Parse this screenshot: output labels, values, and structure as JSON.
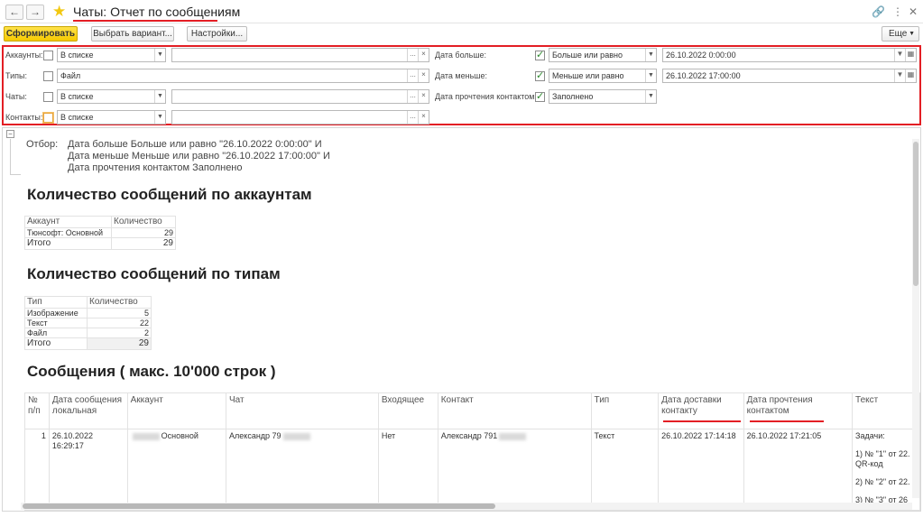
{
  "window": {
    "title": "Чаты: Отчет по сообщениям"
  },
  "toolbar": {
    "generate": "Сформировать",
    "select_variant": "Выбрать вариант...",
    "settings": "Настройки...",
    "more": "Еще"
  },
  "filters": {
    "accounts": {
      "label": "Аккаунты:",
      "checked": false,
      "condition": "В списке",
      "value": ""
    },
    "types": {
      "label": "Типы:",
      "checked": false,
      "condition": "Файл",
      "value": ""
    },
    "chats": {
      "label": "Чаты:",
      "checked": false,
      "condition": "В списке",
      "value": ""
    },
    "contacts": {
      "label": "Контакты:",
      "checked": false,
      "condition": "В списке",
      "value": ""
    },
    "date_greater": {
      "label": "Дата больше:",
      "checked": true,
      "condition": "Больше или равно",
      "value": "26.10.2022  0:00:00"
    },
    "date_less": {
      "label": "Дата меньше:",
      "checked": true,
      "condition": "Меньше или равно",
      "value": "26.10.2022 17:00:00"
    },
    "read_date": {
      "label": "Дата прочтения контактом:",
      "checked": true,
      "condition": "Заполнено"
    }
  },
  "report": {
    "otbor_label": "Отбор:",
    "otbor_lines": [
      "Дата больше Больше или равно \"26.10.2022 0:00:00\" И",
      "Дата меньше Меньше или равно \"26.10.2022 17:00:00\" И",
      "Дата прочтения контактом Заполнено"
    ],
    "section1": {
      "title": "Количество сообщений по аккаунтам",
      "headers": [
        "Аккаунт",
        "Количество"
      ],
      "rows": [
        [
          "Тюнсофт: Основной",
          "29"
        ]
      ],
      "total": [
        "Итого",
        "29"
      ]
    },
    "section2": {
      "title": "Количество сообщений по типам",
      "headers": [
        "Тип",
        "Количество"
      ],
      "rows": [
        [
          "Изображение",
          "5"
        ],
        [
          "Текст",
          "22"
        ],
        [
          "Файл",
          "2"
        ]
      ],
      "total": [
        "Итого",
        "29"
      ]
    },
    "section3": {
      "title": "Сообщения ( макс. 10'000 строк )",
      "headers": [
        "№ п/п",
        "Дата сообщения локальная",
        "Аккаунт",
        "Чат",
        "Входящее",
        "Контакт",
        "Тип",
        "Дата доставки контакту",
        "Дата прочтения контактом",
        "Текст"
      ],
      "row": {
        "n": "1",
        "date": "26.10.2022 16:29:17",
        "account": "Основной",
        "chat": "Александр 79",
        "incoming": "Нет",
        "contact": "Александр 791",
        "type": "Текст",
        "delivered": "26.10.2022 17:14:18",
        "read": "26.10.2022 17:21:05",
        "text_lines": [
          "Задачи:",
          "1) № \"1\" от 22.",
          "QR-код",
          "2) № \"2\" от 22.",
          "3) № \"3\" от 26"
        ]
      }
    }
  },
  "colors": {
    "accent_red": "#e31e24",
    "primary_button": "#f5c900",
    "star": "#f2c811"
  }
}
